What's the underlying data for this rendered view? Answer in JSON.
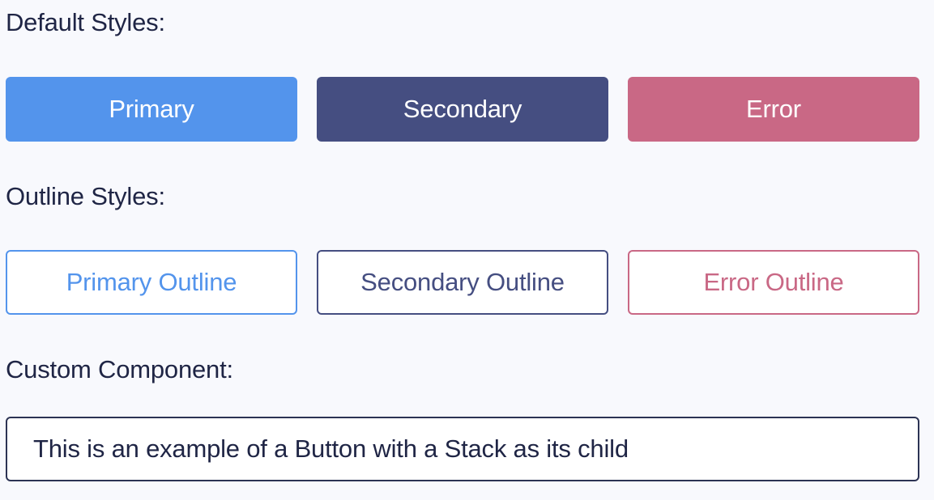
{
  "sections": {
    "default_label": "Default Styles:",
    "outline_label": "Outline Styles:",
    "custom_label": "Custom Component:"
  },
  "default_buttons": {
    "primary": "Primary",
    "secondary": "Secondary",
    "error": "Error"
  },
  "outline_buttons": {
    "primary": "Primary Outline",
    "secondary": "Secondary Outline",
    "error": "Error Outline"
  },
  "custom_button": {
    "text": "This is an example of a Button with a Stack as its child"
  },
  "colors": {
    "background": "#f8f9fd",
    "primary": "#5394ec",
    "secondary": "#454e81",
    "error": "#c96885",
    "text": "#1f2545"
  }
}
